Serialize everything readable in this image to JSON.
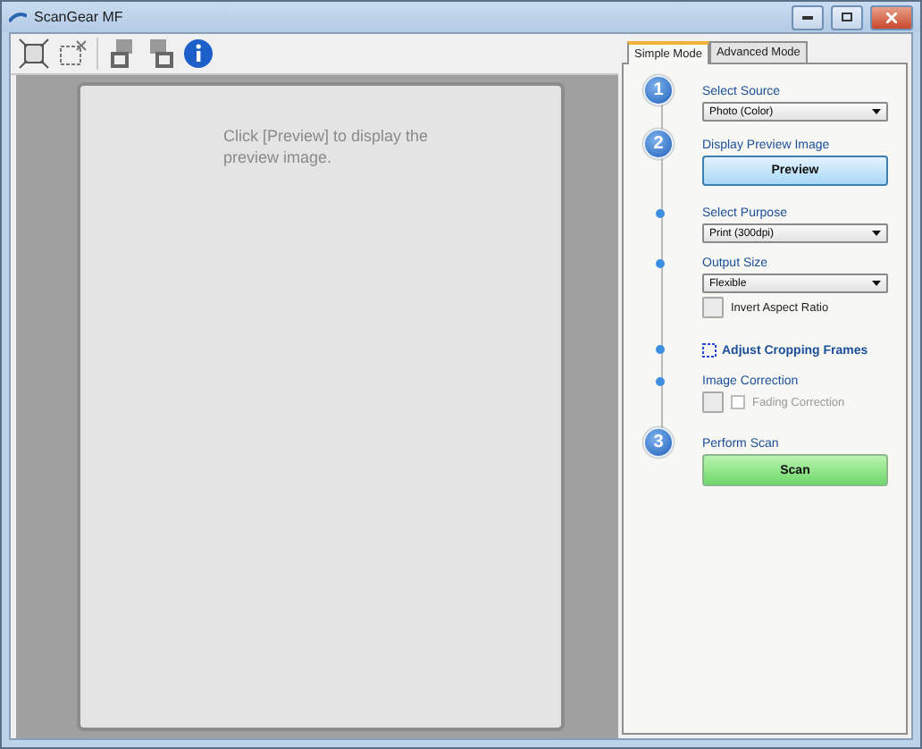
{
  "window": {
    "title": "ScanGear MF"
  },
  "preview": {
    "message": "Click [Preview] to display the preview image."
  },
  "tabs": [
    {
      "label": "Simple Mode",
      "selected": true
    },
    {
      "label": "Advanced Mode",
      "selected": false
    }
  ],
  "steps": [
    {
      "kind": "major",
      "number": "1",
      "label": "Select Source",
      "select": "Photo (Color)"
    },
    {
      "kind": "major",
      "number": "2",
      "label": "Display Preview Image",
      "button": {
        "label": "Preview"
      }
    },
    {
      "kind": "minor",
      "label": "Select Purpose",
      "select": "Print (300dpi)"
    },
    {
      "kind": "minor",
      "label": "Output Size",
      "select": "Flexible",
      "toggle": {
        "label": "Invert Aspect Ratio"
      }
    },
    {
      "kind": "crop",
      "label": "Adjust Cropping Frames"
    },
    {
      "kind": "minor",
      "label": "Image Correction",
      "checkbox": {
        "label": "Fading Correction",
        "checked": false,
        "disabled": true
      }
    },
    {
      "kind": "major",
      "number": "3",
      "label": "Perform Scan",
      "button": {
        "label": "Scan"
      }
    }
  ]
}
